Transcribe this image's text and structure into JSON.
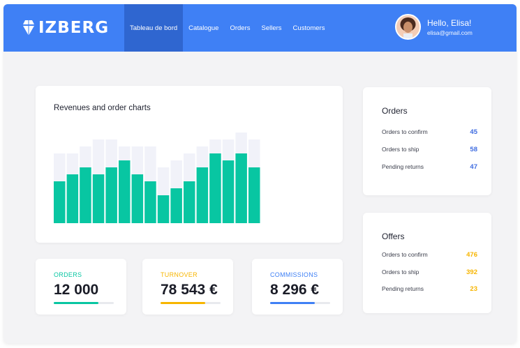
{
  "brand": {
    "name": "IZBERG",
    "icon": "diamond-logo-icon"
  },
  "nav": {
    "items": [
      {
        "label": "Tableau de bord",
        "active": true
      },
      {
        "label": "Catalogue",
        "active": false
      },
      {
        "label": "Orders",
        "active": false
      },
      {
        "label": "Sellers",
        "active": false
      },
      {
        "label": "Customers",
        "active": false
      }
    ]
  },
  "user": {
    "greeting": "Hello, Elisa!",
    "email": "elisa@gmail.com",
    "avatar": "user-avatar"
  },
  "chart": {
    "title": "Revenues and order charts"
  },
  "chart_data": {
    "type": "bar",
    "title": "Revenues and order charts",
    "categories": [
      "",
      "",
      "",
      "",
      "",
      "",
      "",
      "",
      "",
      "",
      "",
      "",
      "",
      "",
      "",
      "",
      "",
      "",
      "",
      "",
      ""
    ],
    "series": [
      {
        "values": [
          6,
          7,
          8,
          7,
          8,
          9,
          7,
          6,
          4,
          5,
          6,
          8,
          10,
          9,
          10,
          8
        ],
        "color": "#08c6a2"
      },
      {
        "values": [
          10,
          10,
          11,
          12,
          12,
          11,
          11,
          11,
          8,
          9,
          10,
          11,
          12,
          12,
          13,
          12
        ],
        "color": "#f1f2f9"
      }
    ],
    "ylim": [
      0,
      14
    ],
    "grid": false
  },
  "stats": {
    "orders": {
      "label": "ORDERS",
      "value": "12 000",
      "progress": 0.74,
      "color": "#08c6a2"
    },
    "turnover": {
      "label": "TURNOVER",
      "value": "78 543 €",
      "progress": 0.74,
      "color": "#f7b500"
    },
    "commissions": {
      "label": "COMMISSIONS",
      "value": "8 296 €",
      "progress": 0.74,
      "color": "#3f80f5"
    }
  },
  "orders_panel": {
    "title": "Orders",
    "color": "#3f6ce0",
    "rows": [
      {
        "label": "Orders to confirm",
        "value": "45"
      },
      {
        "label": "Orders to ship",
        "value": "58"
      },
      {
        "label": "Pending returns",
        "value": "47"
      }
    ]
  },
  "offers_panel": {
    "title": "Offers",
    "color": "#f7b500",
    "rows": [
      {
        "label": "Orders to confirm",
        "value": "476"
      },
      {
        "label": "Orders to ship",
        "value": "392"
      },
      {
        "label": "Pending returns",
        "value": "23"
      }
    ]
  }
}
